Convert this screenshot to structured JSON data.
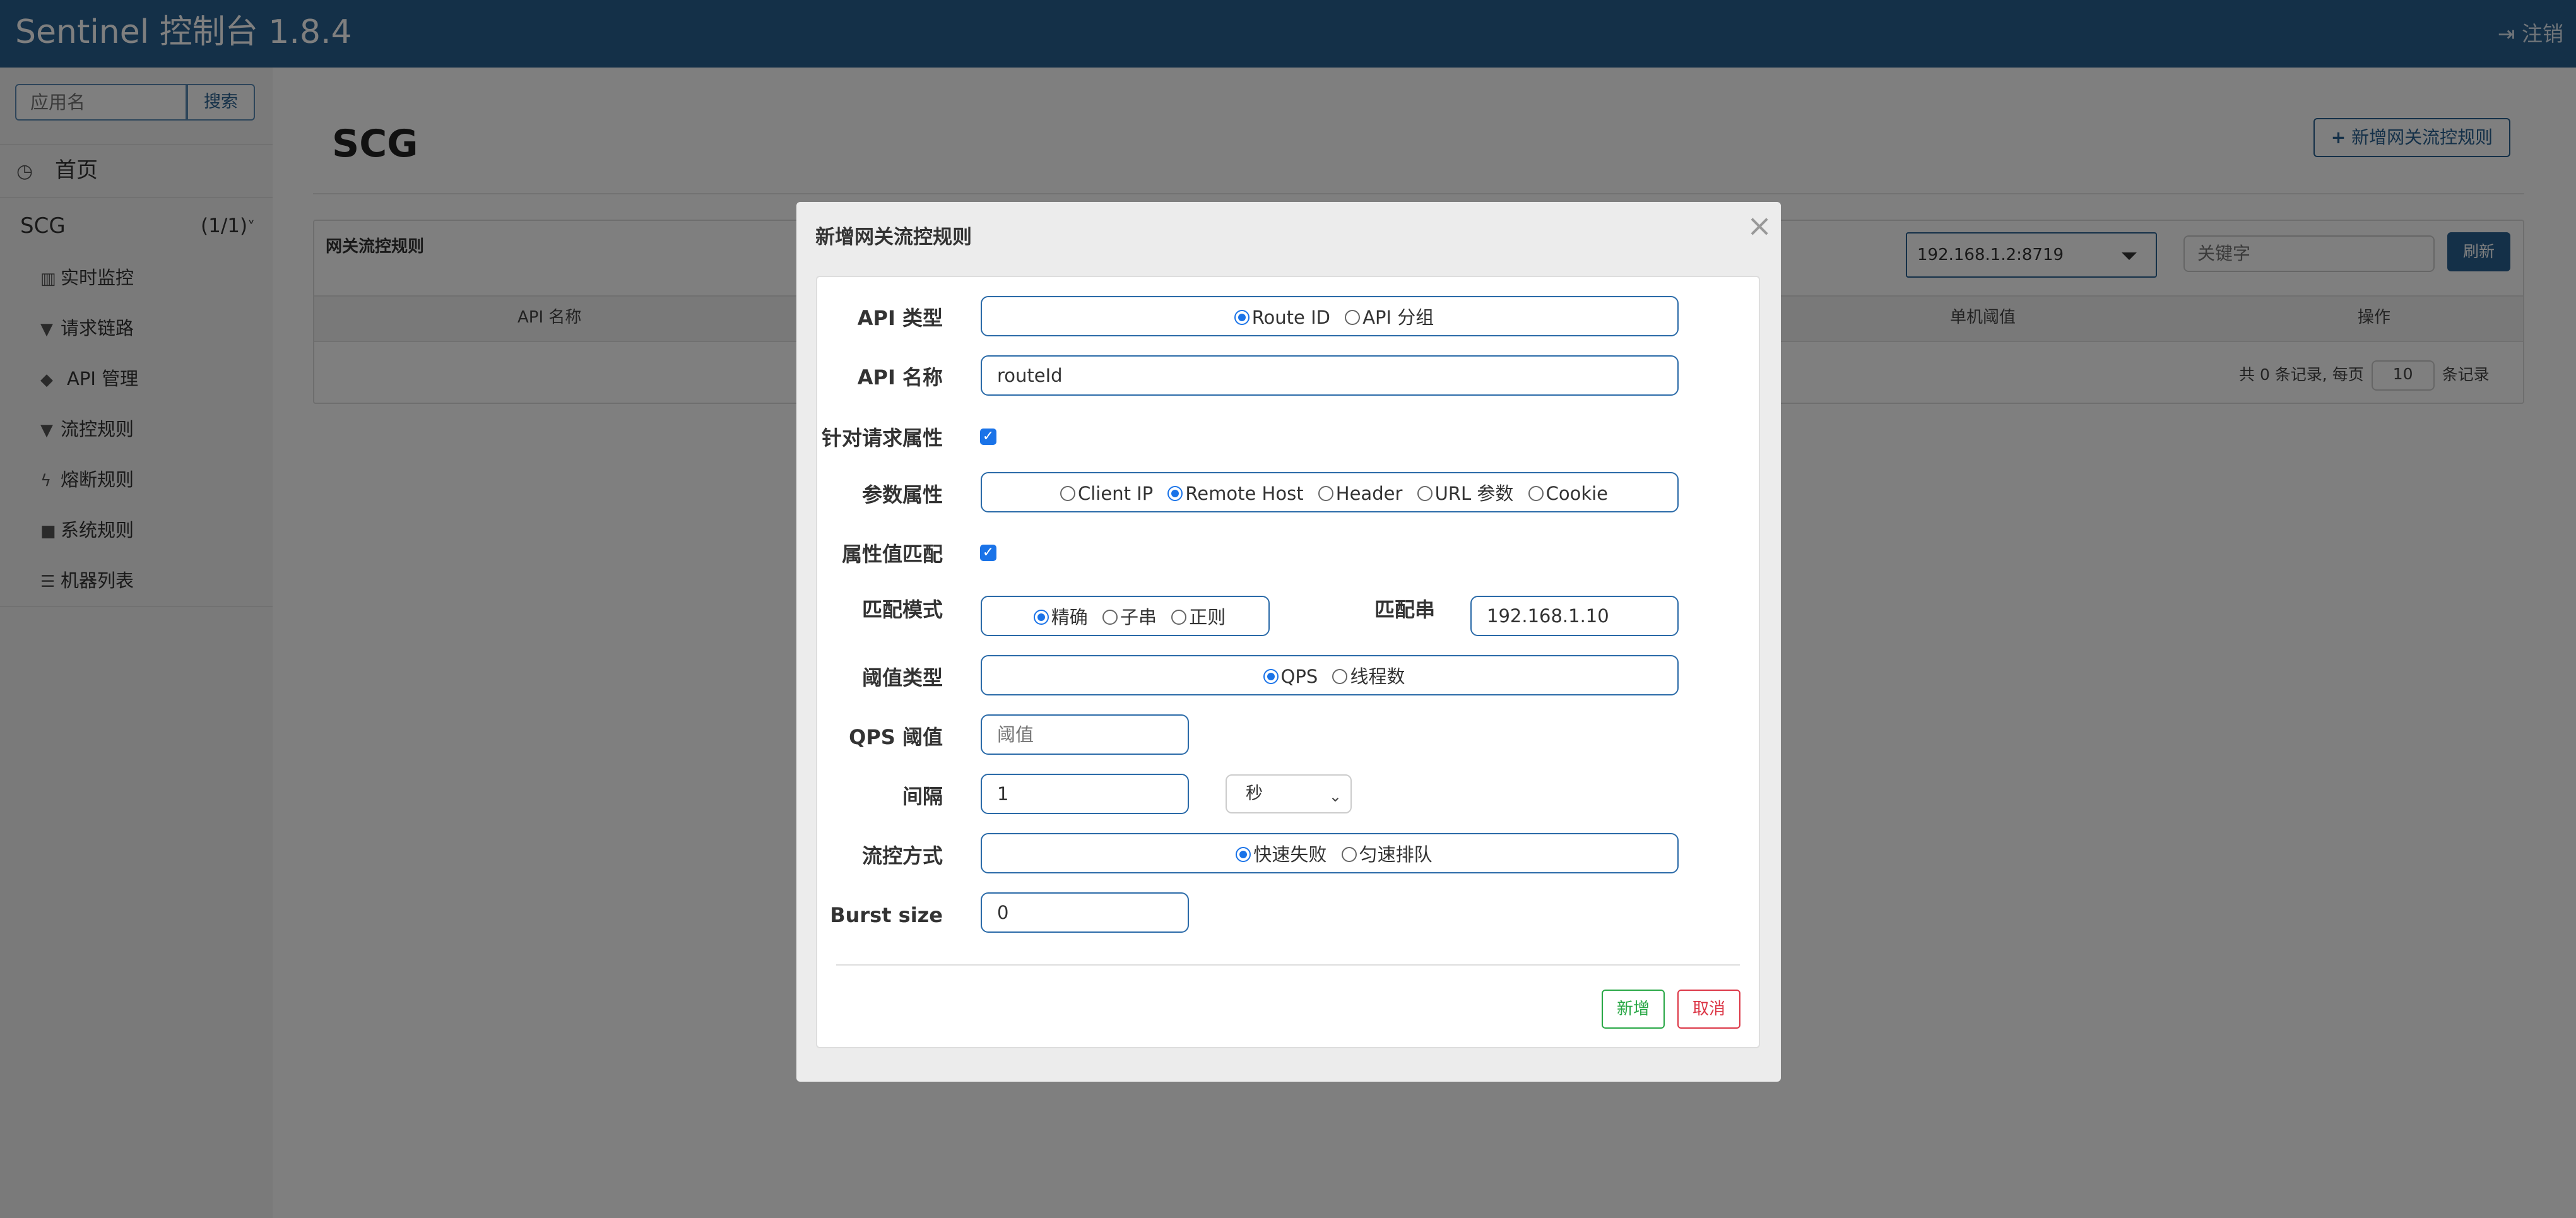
{
  "header": {
    "brand": "Sentinel 控制台 1.8.4",
    "logout_icon": "sign-out-icon",
    "logout": "注销"
  },
  "sidebar": {
    "search_placeholder": "应用名",
    "search_button": "搜索",
    "home": "首页",
    "app_name": "SCG",
    "app_count": "(1/1)",
    "items": [
      {
        "icon": "bar-chart-icon",
        "label": "实时监控"
      },
      {
        "icon": "filter-icon",
        "label": "请求链路"
      },
      {
        "icon": "tags-icon",
        "label": "API 管理"
      },
      {
        "icon": "filter-icon",
        "label": "流控规则"
      },
      {
        "icon": "bolt-icon",
        "label": "熔断规则"
      },
      {
        "icon": "lock-icon",
        "label": "系统规则"
      },
      {
        "icon": "list-icon",
        "label": "机器列表"
      }
    ]
  },
  "main": {
    "title": "SCG",
    "add_button": "新增网关流控规则",
    "panel_title": "网关流控规则",
    "machine": "192.168.1.2:8719",
    "keyword_placeholder": "关键字",
    "refresh": "刷新",
    "columns": [
      "API 名称",
      "单机阈值",
      "操作"
    ],
    "pager": {
      "prefix": "共 0 条记录, 每页",
      "page_size": "10",
      "suffix": "条记录"
    }
  },
  "modal": {
    "title": "新增网关流控规则",
    "close": "×",
    "api_type": {
      "label": "API 类型",
      "options": [
        "Route ID",
        "API 分组"
      ],
      "selected": "Route ID"
    },
    "api_name": {
      "label": "API 名称",
      "value": "routeId"
    },
    "request_attr": {
      "label": "针对请求属性",
      "checked": true
    },
    "param_attr": {
      "label": "参数属性",
      "options": [
        "Client IP",
        "Remote Host",
        "Header",
        "URL 参数",
        "Cookie"
      ],
      "selected": "Remote Host"
    },
    "attr_match": {
      "label": "属性值匹配",
      "checked": true
    },
    "match_mode": {
      "label": "匹配模式",
      "options": [
        "精确",
        "子串",
        "正则"
      ],
      "selected": "精确"
    },
    "match_string": {
      "label": "匹配串",
      "value": "192.168.1.10"
    },
    "threshold_type": {
      "label": "阈值类型",
      "options": [
        "QPS",
        "线程数"
      ],
      "selected": "QPS"
    },
    "qps": {
      "label": "QPS 阈值",
      "placeholder": "阈值"
    },
    "interval": {
      "label": "间隔",
      "value": "1",
      "unit": "秒"
    },
    "control": {
      "label": "流控方式",
      "options": [
        "快速失败",
        "匀速排队"
      ],
      "selected": "快速失败"
    },
    "burst": {
      "label": "Burst size",
      "value": "0"
    },
    "add": "新增",
    "cancel": "取消"
  }
}
